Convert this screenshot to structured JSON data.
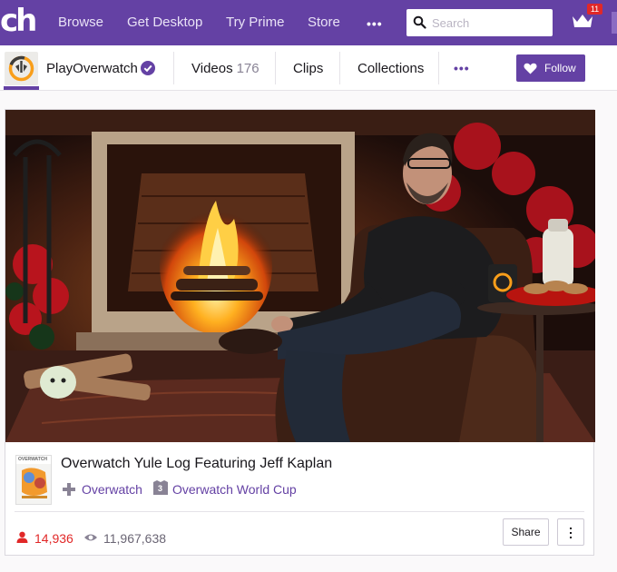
{
  "topnav": {
    "logo": "ch",
    "links": [
      {
        "label": "Browse"
      },
      {
        "label": "Get Desktop"
      },
      {
        "label": "Try Prime"
      },
      {
        "label": "Store"
      }
    ],
    "more": "•••",
    "search_placeholder": "Search",
    "notification_count": "11"
  },
  "channel": {
    "name": "PlayOverwatch",
    "tabs": {
      "videos_label": "Videos",
      "videos_count": "176",
      "clips_label": "Clips",
      "collections_label": "Collections"
    },
    "more": "•••",
    "follow_label": "Follow"
  },
  "video": {
    "title": "Overwatch Yule Log Featuring Jeff Kaplan",
    "game_box_text": "OVERWATCH",
    "game": "Overwatch",
    "collection": "Overwatch World Cup",
    "collection_icon_text": "3",
    "likes": "14,936",
    "views": "11,967,638",
    "share_label": "Share"
  },
  "colors": {
    "brand": "#6441a4",
    "like_red": "#e12828"
  }
}
